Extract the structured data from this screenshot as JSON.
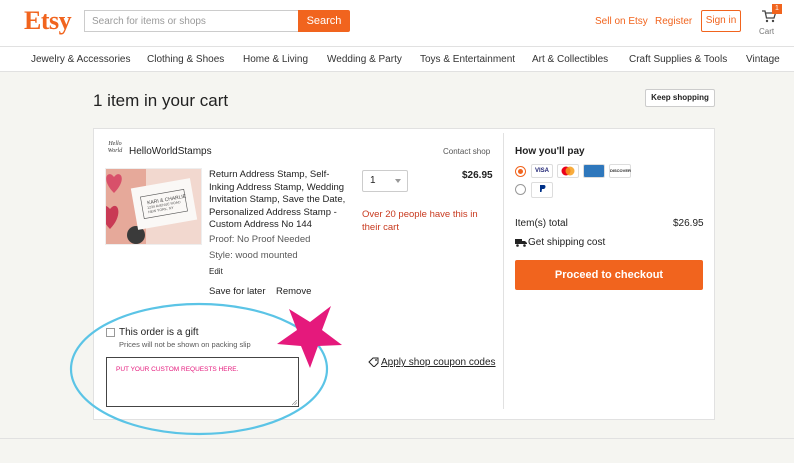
{
  "header": {
    "logo": "Etsy",
    "search_placeholder": "Search for items or shops",
    "search_button": "Search",
    "sell_link": "Sell on Etsy",
    "register_link": "Register",
    "signin_button": "Sign in",
    "cart_count": "1",
    "cart_label": "Cart"
  },
  "nav": {
    "items": [
      "Jewelry & Accessories",
      "Clothing & Shoes",
      "Home & Living",
      "Wedding & Party",
      "Toys & Entertainment",
      "Art & Collectibles",
      "Craft Supplies & Tools",
      "Vintage"
    ]
  },
  "cart": {
    "title": "1 item in your cart",
    "keep_shopping": "Keep shopping"
  },
  "shop": {
    "logo_text": "Hello World",
    "name": "HelloWorldStamps",
    "contact": "Contact shop"
  },
  "item": {
    "title": "Return Address Stamp, Self-Inking Address Stamp, Wedding Invitation Stamp, Save the Date, Personalized Address Stamp - Custom Address No 144",
    "proof": "Proof: No Proof Needed",
    "style": "Style: wood mounted",
    "edit": "Edit",
    "save_later": "Save for later",
    "remove": "Remove",
    "quantity": "1",
    "price": "$26.95",
    "popularity": "Over 20 people have this in their cart",
    "stamp_line1": "KARI & CHARLIE",
    "stamp_line2": "1234 AVENUE ROAD",
    "stamp_line3": "NEW YORK, NY"
  },
  "gift": {
    "label": "This order is a gift",
    "subtext": "Prices will not be shown on packing slip",
    "requests_text": "PUT YOUR CUSTOM REQUESTS HERE."
  },
  "coupon": {
    "label": "Apply shop coupon codes"
  },
  "payment": {
    "title": "How you'll pay",
    "cards": [
      "VISA",
      "MC",
      "AMEX",
      "DISCOVER"
    ],
    "paypal": "PayPal",
    "total_label": "Item(s) total",
    "total_value": "$26.95",
    "shipping_label": "Get shipping cost",
    "checkout_button": "Proceed to checkout"
  },
  "colors": {
    "brand": "#f1641e",
    "annotation_circle": "#5bc4e6",
    "annotation_star": "#e5197c",
    "alert_text": "#c83a1f"
  }
}
